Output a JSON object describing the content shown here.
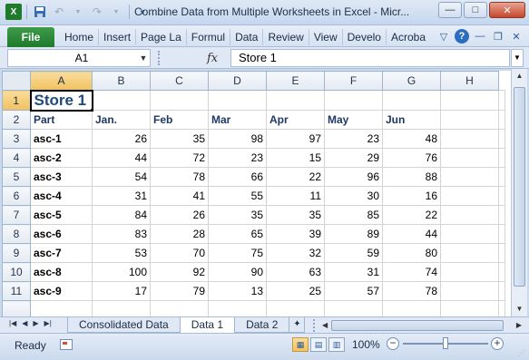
{
  "window": {
    "title": "Combine Data from Multiple Worksheets in Excel  -  Micr...",
    "minimize": "—",
    "maximize": "□",
    "close": "✕"
  },
  "qat": {
    "app_icon": "excel-icon",
    "save_icon": "save-icon",
    "undo_icon": "undo-icon",
    "redo_icon": "redo-icon",
    "customize_icon": "dropdown-icon"
  },
  "ribbon": {
    "file": "File",
    "tabs": [
      "Home",
      "Insert",
      "Page La",
      "Formul",
      "Data",
      "Review",
      "View",
      "Develo",
      "Acroba"
    ],
    "help": "?"
  },
  "formula_bar": {
    "name_box": "A1",
    "fx": "fx",
    "content": "Store 1"
  },
  "grid": {
    "col_headers": [
      "A",
      "B",
      "C",
      "D",
      "E",
      "F",
      "G",
      "H"
    ],
    "rows": [
      {
        "num": "1",
        "cells": [
          "Store 1",
          "",
          "",
          "",
          "",
          "",
          "",
          ""
        ]
      },
      {
        "num": "2",
        "cells": [
          "Part",
          "Jan.",
          "Feb",
          "Mar",
          "Apr",
          "May",
          "Jun",
          ""
        ]
      },
      {
        "num": "3",
        "cells": [
          "asc-1",
          "26",
          "35",
          "98",
          "97",
          "23",
          "48",
          ""
        ]
      },
      {
        "num": "4",
        "cells": [
          "asc-2",
          "44",
          "72",
          "23",
          "15",
          "29",
          "76",
          ""
        ]
      },
      {
        "num": "5",
        "cells": [
          "asc-3",
          "54",
          "78",
          "66",
          "22",
          "96",
          "88",
          ""
        ]
      },
      {
        "num": "6",
        "cells": [
          "asc-4",
          "31",
          "41",
          "55",
          "11",
          "30",
          "16",
          ""
        ]
      },
      {
        "num": "7",
        "cells": [
          "asc-5",
          "84",
          "26",
          "35",
          "35",
          "85",
          "22",
          ""
        ]
      },
      {
        "num": "8",
        "cells": [
          "asc-6",
          "83",
          "28",
          "65",
          "39",
          "89",
          "44",
          ""
        ]
      },
      {
        "num": "9",
        "cells": [
          "asc-7",
          "53",
          "70",
          "75",
          "32",
          "59",
          "80",
          ""
        ]
      },
      {
        "num": "10",
        "cells": [
          "asc-8",
          "100",
          "92",
          "90",
          "63",
          "31",
          "74",
          ""
        ]
      },
      {
        "num": "11",
        "cells": [
          "asc-9",
          "17",
          "79",
          "13",
          "25",
          "57",
          "78",
          ""
        ]
      }
    ]
  },
  "sheets": {
    "tabs": [
      "Consolidated Data",
      "Data 1",
      "Data 2"
    ],
    "active": "Data 1"
  },
  "status": {
    "text": "Ready",
    "zoom": "100%",
    "zoom_level_percent": 100
  }
}
